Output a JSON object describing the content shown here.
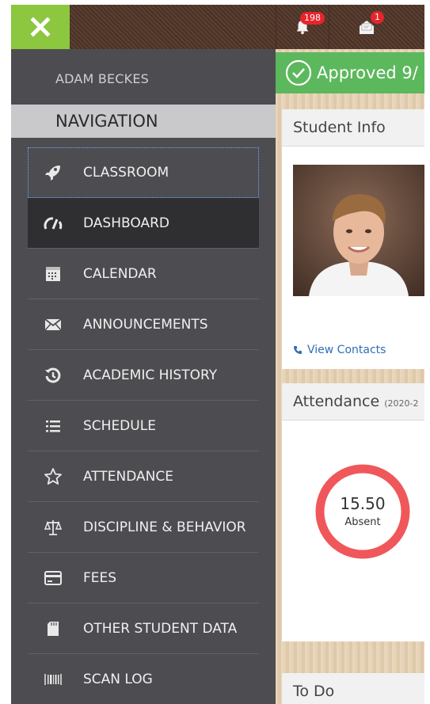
{
  "topbar": {
    "notifications_count": "198",
    "messages_count": "1",
    "accent_color": "#8dc63f"
  },
  "sidebar": {
    "user_name": "ADAM BECKES",
    "nav_header": "NAVIGATION",
    "items": [
      {
        "label": "CLASSROOM",
        "icon": "rocket-icon"
      },
      {
        "label": "DASHBOARD",
        "icon": "speedometer-icon"
      },
      {
        "label": "CALENDAR",
        "icon": "calendar-icon"
      },
      {
        "label": "ANNOUNCEMENTS",
        "icon": "envelope-icon"
      },
      {
        "label": "ACADEMIC HISTORY",
        "icon": "history-icon"
      },
      {
        "label": "SCHEDULE",
        "icon": "list-icon"
      },
      {
        "label": "ATTENDANCE",
        "icon": "star-icon"
      },
      {
        "label": "DISCIPLINE & BEHAVIOR",
        "icon": "scales-icon"
      },
      {
        "label": "FEES",
        "icon": "credit-card-icon"
      },
      {
        "label": "OTHER STUDENT DATA",
        "icon": "sd-card-icon"
      },
      {
        "label": "SCAN LOG",
        "icon": "barcode-icon"
      }
    ]
  },
  "main": {
    "approved_text": "Approved 9/",
    "student_info_title": "Student Info",
    "view_contacts": "View Contacts",
    "attendance_title": "Attendance",
    "attendance_period": "(2020-2",
    "absent_value": "15.50",
    "absent_label": "Absent",
    "todo_title": "To Do"
  },
  "colors": {
    "sidebar_bg": "#4d4d51",
    "active_bg": "#2f2f32",
    "approved_green": "#5cb85c",
    "badge_red": "#e8242c",
    "ring_red": "#f0575b",
    "link_blue": "#2d6fb5"
  }
}
